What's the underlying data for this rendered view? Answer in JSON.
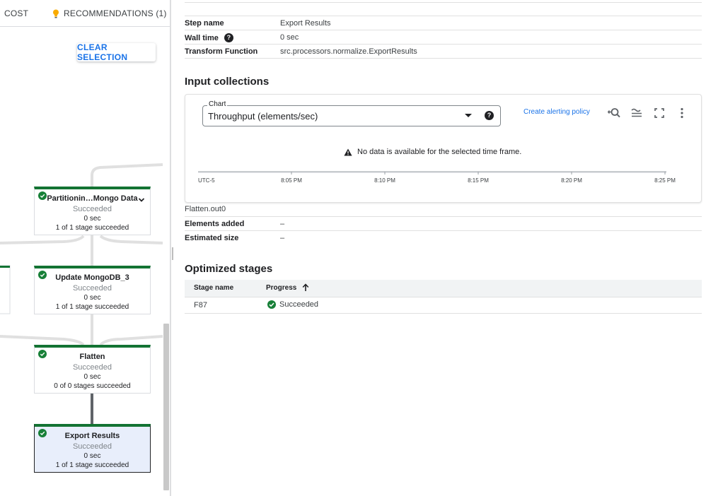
{
  "tabs": {
    "cost": "COST",
    "recommendations": "RECOMMENDATIONS (1)"
  },
  "graph": {
    "clear_selection": "CLEAR SELECTION",
    "nodes": [
      {
        "title": "Partitionin…Mongo Data",
        "status": "Succeeded",
        "duration": "0 sec",
        "stages": "1 of 1 stage succeeded",
        "expandable": true,
        "selected": false
      },
      {
        "title": "Update MongoDB_3",
        "status": "Succeeded",
        "duration": "0 sec",
        "stages": "1 of 1 stage succeeded",
        "expandable": false,
        "selected": false
      },
      {
        "title": "Flatten",
        "status": "Succeeded",
        "duration": "0 sec",
        "stages": "0 of 0 stages succeeded",
        "expandable": false,
        "selected": false
      },
      {
        "title": "Export Results",
        "status": "Succeeded",
        "duration": "0 sec",
        "stages": "1 of 1 stage succeeded",
        "expandable": false,
        "selected": true
      }
    ]
  },
  "details": {
    "step_name_label": "Step name",
    "step_name_value": "Export Results",
    "wall_time_label": "Wall time",
    "wall_time_value": "0 sec",
    "transform_label": "Transform Function",
    "transform_value": "src.processors.normalize.ExportResults"
  },
  "input_collections": {
    "title": "Input collections",
    "chart_label": "Chart",
    "chart_value": "Throughput (elements/sec)",
    "alert_link": "Create alerting policy",
    "no_data": "No data is available for the selected time frame.",
    "collection_name": "Flatten.out0",
    "elements_added_label": "Elements added",
    "elements_added_value": "–",
    "estimated_size_label": "Estimated size",
    "estimated_size_value": "–"
  },
  "chart_data": {
    "type": "line",
    "x_ticks": [
      "UTC-5",
      "8:05 PM",
      "8:10 PM",
      "8:15 PM",
      "8:20 PM",
      "8:25 PM"
    ],
    "series": [],
    "title": "",
    "xlabel": "",
    "ylabel": ""
  },
  "optimized_stages": {
    "title": "Optimized stages",
    "columns": {
      "stage_name": "Stage name",
      "progress": "Progress"
    },
    "rows": [
      {
        "stage_name": "F87",
        "progress": "Succeeded"
      }
    ]
  },
  "colors": {
    "success": "#188038",
    "accent": "#1a73e8",
    "bulb": "#f9ab00"
  }
}
